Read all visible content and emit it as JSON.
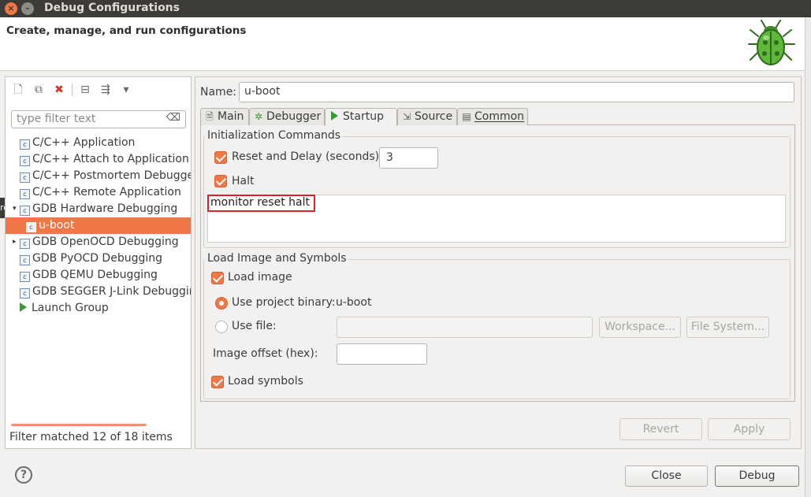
{
  "window": {
    "title": "Debug Configurations",
    "close_glyph": "×",
    "minimize_glyph": "–"
  },
  "header": {
    "title": "Create, manage, and run configurations",
    "icon": "bug-icon"
  },
  "left_panel": {
    "toolbar": [
      {
        "name": "new-config-icon",
        "glyph": "🗋"
      },
      {
        "name": "duplicate-icon",
        "glyph": "⧉"
      },
      {
        "name": "delete-icon",
        "glyph": "✖"
      },
      {
        "name": "collapse-all-icon",
        "glyph": "⊟"
      },
      {
        "name": "filter-icon",
        "glyph": "⇶"
      },
      {
        "name": "view-menu-icon",
        "glyph": "▾"
      }
    ],
    "filter_placeholder": "type filter text",
    "filter_clear_glyph": "⌫",
    "tree": [
      {
        "label": "C/C++ Application",
        "icon": "c",
        "indent": 0,
        "twisty": ""
      },
      {
        "label": "C/C++ Attach to Application",
        "icon": "c",
        "indent": 0,
        "twisty": ""
      },
      {
        "label": "C/C++ Postmortem Debugger",
        "icon": "c",
        "indent": 0,
        "twisty": ""
      },
      {
        "label": "C/C++ Remote Application",
        "icon": "c",
        "indent": 0,
        "twisty": ""
      },
      {
        "label": "GDB Hardware Debugging",
        "icon": "c",
        "indent": 0,
        "twisty": "▾"
      },
      {
        "label": "u-boot",
        "icon": "c",
        "indent": 1,
        "twisty": "",
        "selected": true
      },
      {
        "label": "GDB OpenOCD Debugging",
        "icon": "c",
        "indent": 0,
        "twisty": "▸"
      },
      {
        "label": "GDB PyOCD Debugging",
        "icon": "c",
        "indent": 0,
        "twisty": ""
      },
      {
        "label": "GDB QEMU Debugging",
        "icon": "c",
        "indent": 0,
        "twisty": ""
      },
      {
        "label": "GDB SEGGER J-Link Debugging",
        "icon": "c",
        "indent": 0,
        "twisty": ""
      },
      {
        "label": "Launch Group",
        "icon": "launch",
        "indent": 0,
        "twisty": ""
      }
    ],
    "status": "Filter matched 12 of 18 items",
    "side_tab_text": "ro"
  },
  "config": {
    "name_label": "Name:",
    "name_value": "u-boot",
    "tabs": [
      {
        "label": "Main",
        "icon": "🗎"
      },
      {
        "label": "Debugger",
        "icon": "✲"
      },
      {
        "label": "Startup",
        "icon": "play",
        "active": true
      },
      {
        "label": "Source",
        "icon": "⇲"
      },
      {
        "label": "Common",
        "icon": "▤"
      }
    ],
    "init": {
      "group_label": "Initialization Commands",
      "reset_label": "Reset and Delay (seconds):",
      "reset_checked": true,
      "delay_value": "3",
      "halt_label": "Halt",
      "halt_checked": true,
      "commands": "monitor reset halt"
    },
    "load": {
      "group_label": "Load Image and Symbols",
      "load_image_label": "Load image",
      "load_image_checked": true,
      "use_project_label": "Use project binary:",
      "project_binary": "u-boot",
      "use_file_label": "Use file:",
      "file_value": "",
      "workspace_button": "Workspace...",
      "filesystem_button": "File System...",
      "offset_label": "Image offset (hex):",
      "offset_value": "",
      "load_symbols_label": "Load symbols",
      "load_symbols_checked": true
    },
    "revert_button": "Revert",
    "apply_button": "Apply"
  },
  "footer": {
    "help_glyph": "?",
    "close_button": "Close",
    "debug_button": "Debug"
  },
  "colors": {
    "accent": "#f07746",
    "titlebar": "#3c3b37",
    "highlight_box": "#d8232a"
  }
}
